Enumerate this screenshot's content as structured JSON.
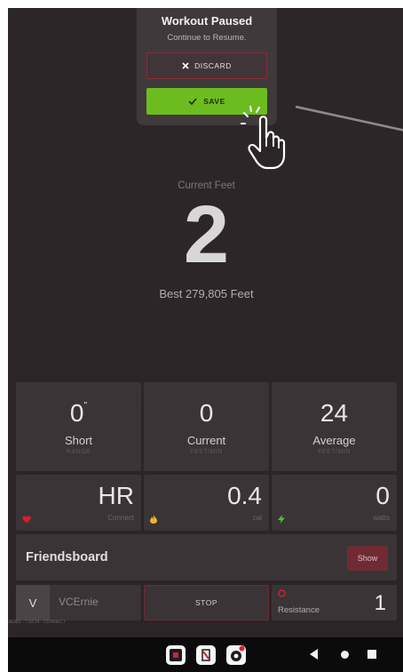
{
  "popup": {
    "title": "Workout Paused",
    "subtitle": "Continue to Resume.",
    "discard_label": "DISCARD",
    "save_label": "SAVE"
  },
  "main": {
    "current_label": "Current Feet",
    "current_value": "2",
    "best_text": "Best 279,805 Feet"
  },
  "tiles": {
    "short": {
      "value": "0",
      "unit_mark": "\"",
      "label": "Short",
      "sub": "RANGE"
    },
    "current": {
      "value": "0",
      "label": "Current",
      "sub": "FEET/MIN"
    },
    "average": {
      "value": "24",
      "label": "Average",
      "sub": "FEET/MIN"
    },
    "hr": {
      "value": "HR",
      "sub": "Connect"
    },
    "cal": {
      "value": "0.4",
      "sub": "cal"
    },
    "watts": {
      "value": "0",
      "sub": "watts"
    }
  },
  "friends": {
    "label": "Friendsboard",
    "show_label": "Show"
  },
  "bottom": {
    "user_initial": "V",
    "user_name": "VCErnie",
    "stop_label": "STOP",
    "resistance_label": "Resistance",
    "resistance_value": "1"
  },
  "version": "3E981 - 7.63.14 - CONNECT",
  "colors": {
    "background": "#2d2629",
    "tile": "#3a3437",
    "save_green": "#6cbc1f",
    "discard_border": "#8a2d35",
    "show_red": "#712a33",
    "heart_red": "#d8202c",
    "flame_yellow": "#e8b52a",
    "bolt_green": "#4fc12e"
  },
  "icons": {
    "discard": "close-icon",
    "save": "check-icon",
    "hand": "hand-pointer-icon",
    "hr": "heart-icon",
    "cal": "flame-icon",
    "watts": "bolt-icon",
    "resistance": "gauge-icon"
  }
}
